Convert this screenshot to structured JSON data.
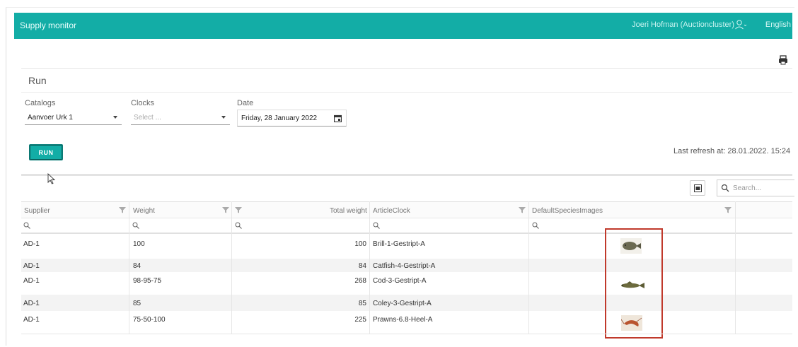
{
  "app": {
    "title": "Supply monitor",
    "user": "Joeri Hofman (Auctioncluster)",
    "language": "English"
  },
  "toolbar": {
    "print_icon": "print-icon"
  },
  "section": {
    "title": "Run"
  },
  "filters": {
    "catalogs": {
      "label": "Catalogs",
      "value": "Aanvoer Urk 1"
    },
    "clocks": {
      "label": "Clocks",
      "placeholder": "Select ..."
    },
    "date": {
      "label": "Date",
      "value": "Friday, 28 January 2022"
    }
  },
  "run_button": {
    "label": "RUN"
  },
  "refresh": {
    "text": "Last refresh at: 28.01.2022. 15:24"
  },
  "grid": {
    "search_placeholder": "Search...",
    "columns": [
      "Supplier",
      "Weight",
      "Total weight",
      "ArticleClock",
      "DefaultSpeciesImages"
    ],
    "rows": [
      {
        "supplier": "AD-1",
        "weight": "100",
        "total": "100",
        "article": "Brill-1-Gestript-A",
        "image": "brill-fish-image"
      },
      {
        "supplier": "AD-1",
        "weight": "84",
        "total": "84",
        "article": "Catfish-4-Gestript-A",
        "image": ""
      },
      {
        "supplier": "AD-1",
        "weight": "98-95-75",
        "total": "268",
        "article": "Cod-3-Gestript-A",
        "image": "cod-fish-image"
      },
      {
        "supplier": "AD-1",
        "weight": "85",
        "total": "85",
        "article": "Coley-3-Gestript-A",
        "image": ""
      },
      {
        "supplier": "AD-1",
        "weight": "75-50-100",
        "total": "225",
        "article": "Prawns-6.8-Heel-A",
        "image": "prawn-image"
      }
    ]
  },
  "colors": {
    "accent": "#13ada6",
    "highlight": "#c0392b"
  }
}
